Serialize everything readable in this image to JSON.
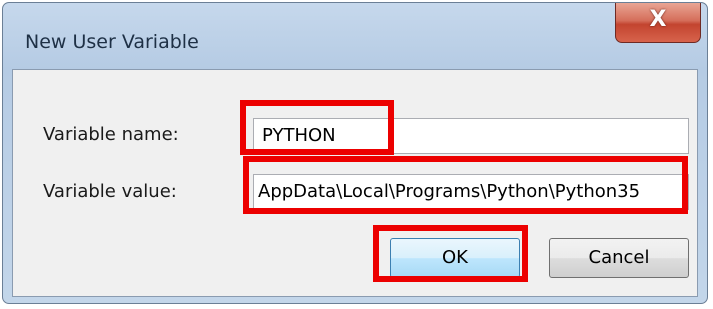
{
  "dialog": {
    "title": "New User Variable",
    "close_label": "X",
    "name_label": "Variable name:",
    "value_label": "Variable value:",
    "name_value": "PYTHON",
    "value_value": "AppData\\Local\\Programs\\Python\\Python35",
    "ok_label": "OK",
    "cancel_label": "Cancel"
  },
  "annotations": {
    "highlight_color": "#ec0000"
  }
}
